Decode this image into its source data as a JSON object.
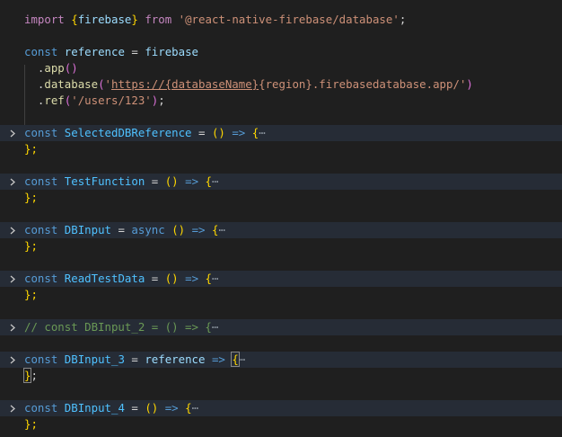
{
  "import_line": {
    "kw_import": "import",
    "brace_open": "{",
    "name": "firebase",
    "brace_close": "}",
    "kw_from": "from",
    "module": "'@react-native-firebase/database'",
    "semi": ";"
  },
  "reference_block": {
    "kw_const": "const",
    "name": "reference",
    "eq": "=",
    "obj": "firebase",
    "app_dot": ".",
    "app": "app",
    "app_parens": "()",
    "db_dot": ".",
    "database": "database",
    "db_open": "(",
    "db_q1": "'",
    "db_url_a": "https://{databaseName}",
    "db_url_b": "{region}.firebasedatabase.app/",
    "db_q2": "'",
    "db_close": ")",
    "ref_dot": ".",
    "ref": "ref",
    "ref_open": "(",
    "ref_arg": "'/users/123'",
    "ref_close": ")",
    "ref_semi": ";"
  },
  "folded_functions": [
    {
      "kw": "const",
      "name": "SelectedDBReference",
      "eq": "=",
      "async": "",
      "params": "()",
      "arrow": "=>",
      "brace": "{",
      "ellipsis": "⋯",
      "closing": "};"
    },
    {
      "kw": "const",
      "name": "TestFunction",
      "eq": "=",
      "async": "",
      "params": "()",
      "arrow": "=>",
      "brace": "{",
      "ellipsis": "⋯",
      "closing": "};"
    },
    {
      "kw": "const",
      "name": "DBInput",
      "eq": "=",
      "async": "async",
      "params": "()",
      "arrow": "=>",
      "brace": "{",
      "ellipsis": "⋯",
      "closing": "};"
    },
    {
      "kw": "const",
      "name": "ReadTestData",
      "eq": "=",
      "async": "",
      "params": "()",
      "arrow": "=>",
      "brace": "{",
      "ellipsis": "⋯",
      "closing": "};"
    }
  ],
  "comment_line": {
    "text": "// const DBInput_2 = () => {",
    "ellipsis": "⋯"
  },
  "folded_functions_2": [
    {
      "kw": "const",
      "name": "DBInput_3",
      "eq": "=",
      "param": "reference",
      "arrow": "=>",
      "brace": "{",
      "ellipsis": "⋯",
      "closing_brace": "}",
      "closing_semi": ";"
    },
    {
      "kw": "const",
      "name": "DBInput_4",
      "eq": "=",
      "params": "()",
      "arrow": "=>",
      "brace": "{",
      "ellipsis": "⋯",
      "closing": "};"
    }
  ],
  "icons": {
    "fold": "chevron-right-icon"
  },
  "colors": {
    "background": "#1f1f1f",
    "folded_line_bg": "#262c36",
    "keyword": "#569cd6",
    "variable": "#9cdcfe",
    "function": "#dcdcaa",
    "string": "#ce9178",
    "brace": "#ffd700",
    "comment": "#6a9955"
  }
}
